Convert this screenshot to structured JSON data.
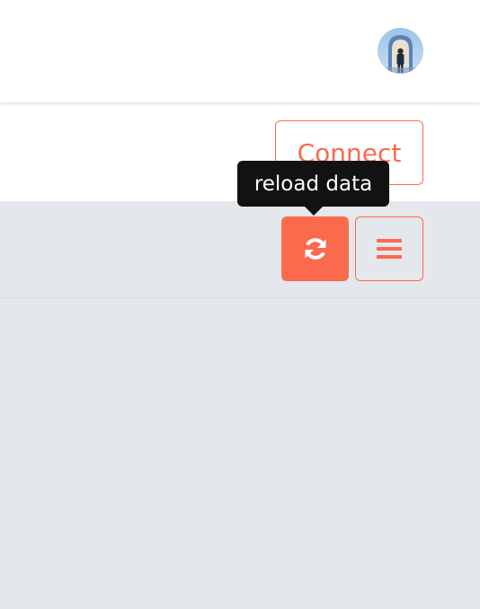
{
  "header": {
    "avatar_icon": "user-avatar"
  },
  "connect": {
    "label": "Connect"
  },
  "toolbar": {
    "reload_icon": "refresh-icon",
    "menu_icon": "hamburger-menu-icon",
    "tooltip": "reload data"
  },
  "colors": {
    "accent": "#fa6a4d",
    "page_bg": "#e4e7ec",
    "header_bg": "#ffffff",
    "tooltip_bg": "#121212"
  }
}
